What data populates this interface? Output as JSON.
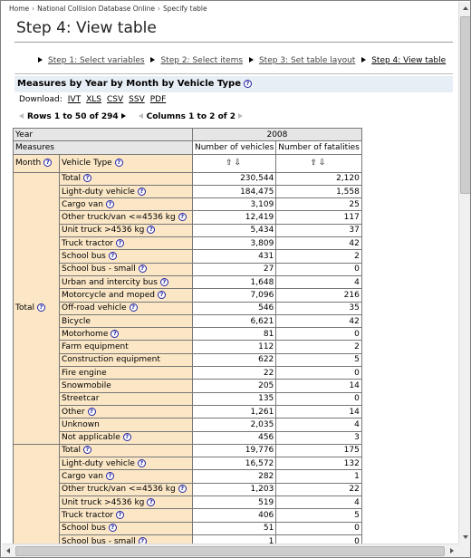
{
  "breadcrumb": [
    "Home",
    "National Collision Database Online",
    "Specify table"
  ],
  "page_title": "Step 4: View table",
  "steps": [
    {
      "label": "Step 1: Select variables"
    },
    {
      "label": "Step 2: Select items"
    },
    {
      "label": "Step 3: Set table layout"
    },
    {
      "label": "Step 4: View table"
    }
  ],
  "panel": {
    "title": "Measures by Year by Month by Vehicle Type",
    "help": "?"
  },
  "download": {
    "label": "Download:",
    "formats": [
      "IVT",
      "XLS",
      "CSV",
      "SSV",
      "PDF"
    ]
  },
  "pager": {
    "rows": "Rows 1 to 50 of 294",
    "columns": "Columns 1 to 2 of 2"
  },
  "table": {
    "year_label": "Year",
    "year_value": "2008",
    "measures_label": "Measures",
    "measure_cols": [
      "Number of vehicles",
      "Number of fatalities"
    ],
    "sort_glyph": "⇧⇩",
    "month_label": "Month",
    "vehicle_type_label": "Vehicle Type",
    "help": "?",
    "group1_label": "Total",
    "group1_rows": [
      {
        "type": "Total",
        "help": true,
        "v": "230,544",
        "f": "2,120"
      },
      {
        "type": "Light-duty vehicle",
        "help": true,
        "v": "184,475",
        "f": "1,558"
      },
      {
        "type": "Cargo van",
        "help": true,
        "v": "3,109",
        "f": "25"
      },
      {
        "type": "Other truck/van <=4536 kg",
        "help": true,
        "v": "12,419",
        "f": "117"
      },
      {
        "type": "Unit truck >4536 kg",
        "help": true,
        "v": "5,434",
        "f": "37"
      },
      {
        "type": "Truck tractor",
        "help": true,
        "v": "3,809",
        "f": "42"
      },
      {
        "type": "School bus",
        "help": true,
        "v": "431",
        "f": "2"
      },
      {
        "type": "School bus - small",
        "help": true,
        "v": "27",
        "f": "0"
      },
      {
        "type": "Urban and intercity bus",
        "help": true,
        "v": "1,648",
        "f": "4"
      },
      {
        "type": "Motorcycle and moped",
        "help": true,
        "v": "7,096",
        "f": "216"
      },
      {
        "type": "Off-road vehicle",
        "help": true,
        "v": "546",
        "f": "35"
      },
      {
        "type": "Bicycle",
        "help": false,
        "v": "6,621",
        "f": "42"
      },
      {
        "type": "Motorhome",
        "help": true,
        "v": "81",
        "f": "0"
      },
      {
        "type": "Farm equipment",
        "help": false,
        "v": "112",
        "f": "2"
      },
      {
        "type": "Construction equipment",
        "help": false,
        "v": "622",
        "f": "5"
      },
      {
        "type": "Fire engine",
        "help": false,
        "v": "22",
        "f": "0"
      },
      {
        "type": "Snowmobile",
        "help": false,
        "v": "205",
        "f": "14"
      },
      {
        "type": "Streetcar",
        "help": false,
        "v": "135",
        "f": "0"
      },
      {
        "type": "Other",
        "help": true,
        "v": "1,261",
        "f": "14"
      },
      {
        "type": "Unknown",
        "help": false,
        "v": "2,035",
        "f": "4"
      },
      {
        "type": "Not applicable",
        "help": true,
        "v": "456",
        "f": "3"
      }
    ],
    "group2_rows": [
      {
        "type": "Total",
        "help": true,
        "v": "19,776",
        "f": "175"
      },
      {
        "type": "Light-duty vehicle",
        "help": true,
        "v": "16,572",
        "f": "132"
      },
      {
        "type": "Cargo van",
        "help": true,
        "v": "282",
        "f": "1"
      },
      {
        "type": "Other truck/van <=4536 kg",
        "help": true,
        "v": "1,203",
        "f": "22"
      },
      {
        "type": "Unit truck >4536 kg",
        "help": true,
        "v": "519",
        "f": "4"
      },
      {
        "type": "Truck tractor",
        "help": true,
        "v": "406",
        "f": "5"
      },
      {
        "type": "School bus",
        "help": true,
        "v": "51",
        "f": "0"
      },
      {
        "type": "School bus - small",
        "help": true,
        "v": "1",
        "f": "0"
      }
    ]
  }
}
